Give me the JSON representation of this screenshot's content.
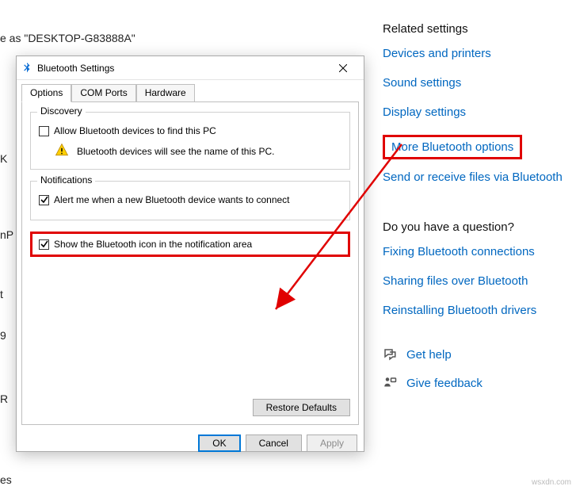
{
  "background": {
    "discoverable_text": "e as \"DESKTOP-G83888A\"",
    "frag1": "K",
    "frag2": "nP",
    "frag3": "t",
    "frag4": "9",
    "frag5": "R",
    "frag6": "es"
  },
  "side": {
    "heading_related": "Related settings",
    "link_devices": "Devices and printers",
    "link_sound": "Sound settings",
    "link_display": "Display settings",
    "link_more_bt": "More Bluetooth options",
    "link_send_recv": "Send or receive files via Bluetooth",
    "heading_question": "Do you have a question?",
    "link_fix": "Fixing Bluetooth connections",
    "link_share": "Sharing files over Bluetooth",
    "link_reinstall": "Reinstalling Bluetooth drivers",
    "get_help": "Get help",
    "give_feedback": "Give feedback"
  },
  "dialog": {
    "title": "Bluetooth Settings",
    "tabs": {
      "options": "Options",
      "com": "COM Ports",
      "hardware": "Hardware"
    },
    "discovery": {
      "legend": "Discovery",
      "allow": "Allow Bluetooth devices to find this PC",
      "warning": "Bluetooth devices will see the name of this PC."
    },
    "notifications": {
      "legend": "Notifications",
      "alert": "Alert me when a new Bluetooth device wants to connect"
    },
    "show_icon": "Show the Bluetooth icon in the notification area",
    "restore": "Restore Defaults",
    "ok": "OK",
    "cancel": "Cancel",
    "apply": "Apply"
  },
  "watermark": "wsxdn.com"
}
